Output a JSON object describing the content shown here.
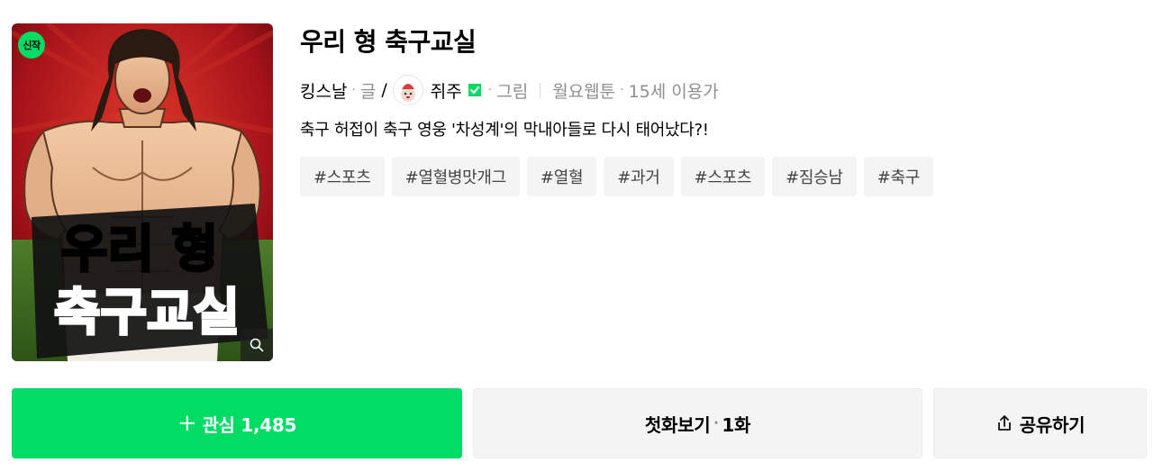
{
  "cover": {
    "badge": "신작",
    "art_line1": "우리 형",
    "art_line2": "축구교실",
    "zoom_icon": "search-icon"
  },
  "title": "우리 형 축구교실",
  "meta": {
    "writer": "킹스날",
    "writer_role": "글",
    "slash": "/",
    "artist": "쥐주",
    "artist_role": "그림",
    "schedule": "월요웹툰",
    "age": "15세 이용가",
    "dot": "·"
  },
  "description": "축구 허접이 축구 영웅 '차성계'의 막내아들로 다시 태어났다?!",
  "tags": [
    "#스포츠",
    "#열혈병맛개그",
    "#열혈",
    "#과거",
    "#스포츠",
    "#짐승남",
    "#축구"
  ],
  "buttons": {
    "favorite_plus": "+",
    "favorite_label": "관심 1,485",
    "first_label": "첫화보기",
    "first_dot": "·",
    "first_episode": "1화",
    "share_label": "공유하기",
    "share_icon": "share-icon"
  },
  "colors": {
    "accent": "#00dc64",
    "tag_bg": "#f4f4f4",
    "muted_text": "#8f8f8f"
  }
}
